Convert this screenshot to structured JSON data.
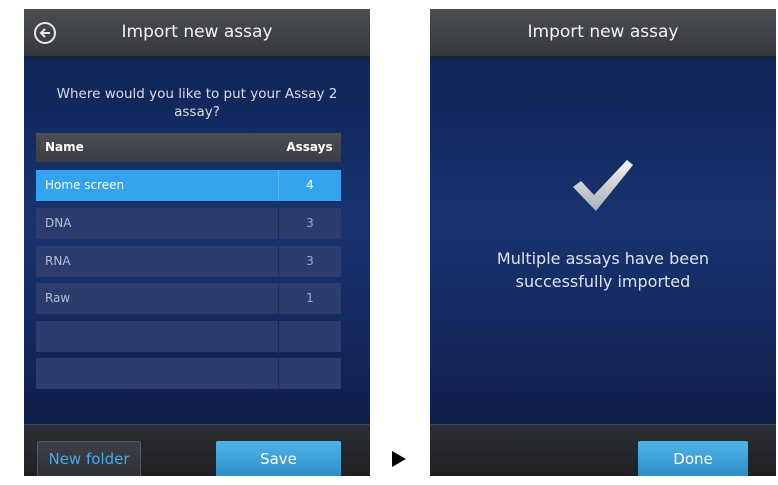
{
  "left_screen": {
    "title": "Import new assay",
    "question": "Where would you like to put your Assay 2 assay?",
    "table": {
      "headers": {
        "name": "Name",
        "assays": "Assays"
      },
      "rows": [
        {
          "name": "Home screen",
          "count": "4"
        },
        {
          "name": "DNA",
          "count": "3"
        },
        {
          "name": "RNA",
          "count": "3"
        },
        {
          "name": "Raw",
          "count": "1"
        },
        {
          "name": "",
          "count": ""
        },
        {
          "name": "",
          "count": ""
        }
      ],
      "selected_row": "Home screen"
    },
    "buttons": {
      "new_folder": "New folder",
      "save": "Save"
    }
  },
  "right_screen": {
    "title": "Import new assay",
    "message": "Multiple assays have been successfully imported",
    "buttons": {
      "done": "Done"
    }
  },
  "icons": {
    "back": "back-arrow-icon",
    "transition": "play-arrow-icon",
    "success": "checkmark-icon"
  },
  "colors": {
    "accent": "#33a3ef",
    "button_blue": "#3f9fd8",
    "link_blue": "#4aa7e6",
    "background_navy": "#0f2456"
  }
}
